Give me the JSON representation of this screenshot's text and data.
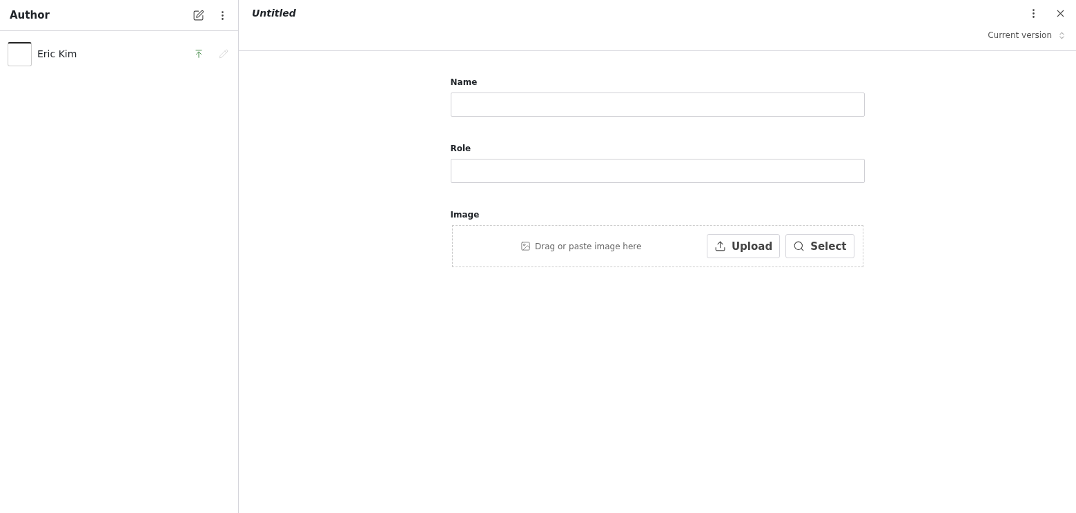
{
  "sidebar": {
    "title": "Author",
    "items": [
      {
        "name": "Eric Kim",
        "selected": false
      }
    ]
  },
  "document": {
    "title": "Untitled",
    "version": "Current version"
  },
  "fields": [
    {
      "kind": "text",
      "label": "Name"
    },
    {
      "kind": "text",
      "label": "Role"
    },
    {
      "kind": "image",
      "label": "Image",
      "hint": "Drag or paste image here",
      "upload": "Upload",
      "select": "Select"
    }
  ]
}
